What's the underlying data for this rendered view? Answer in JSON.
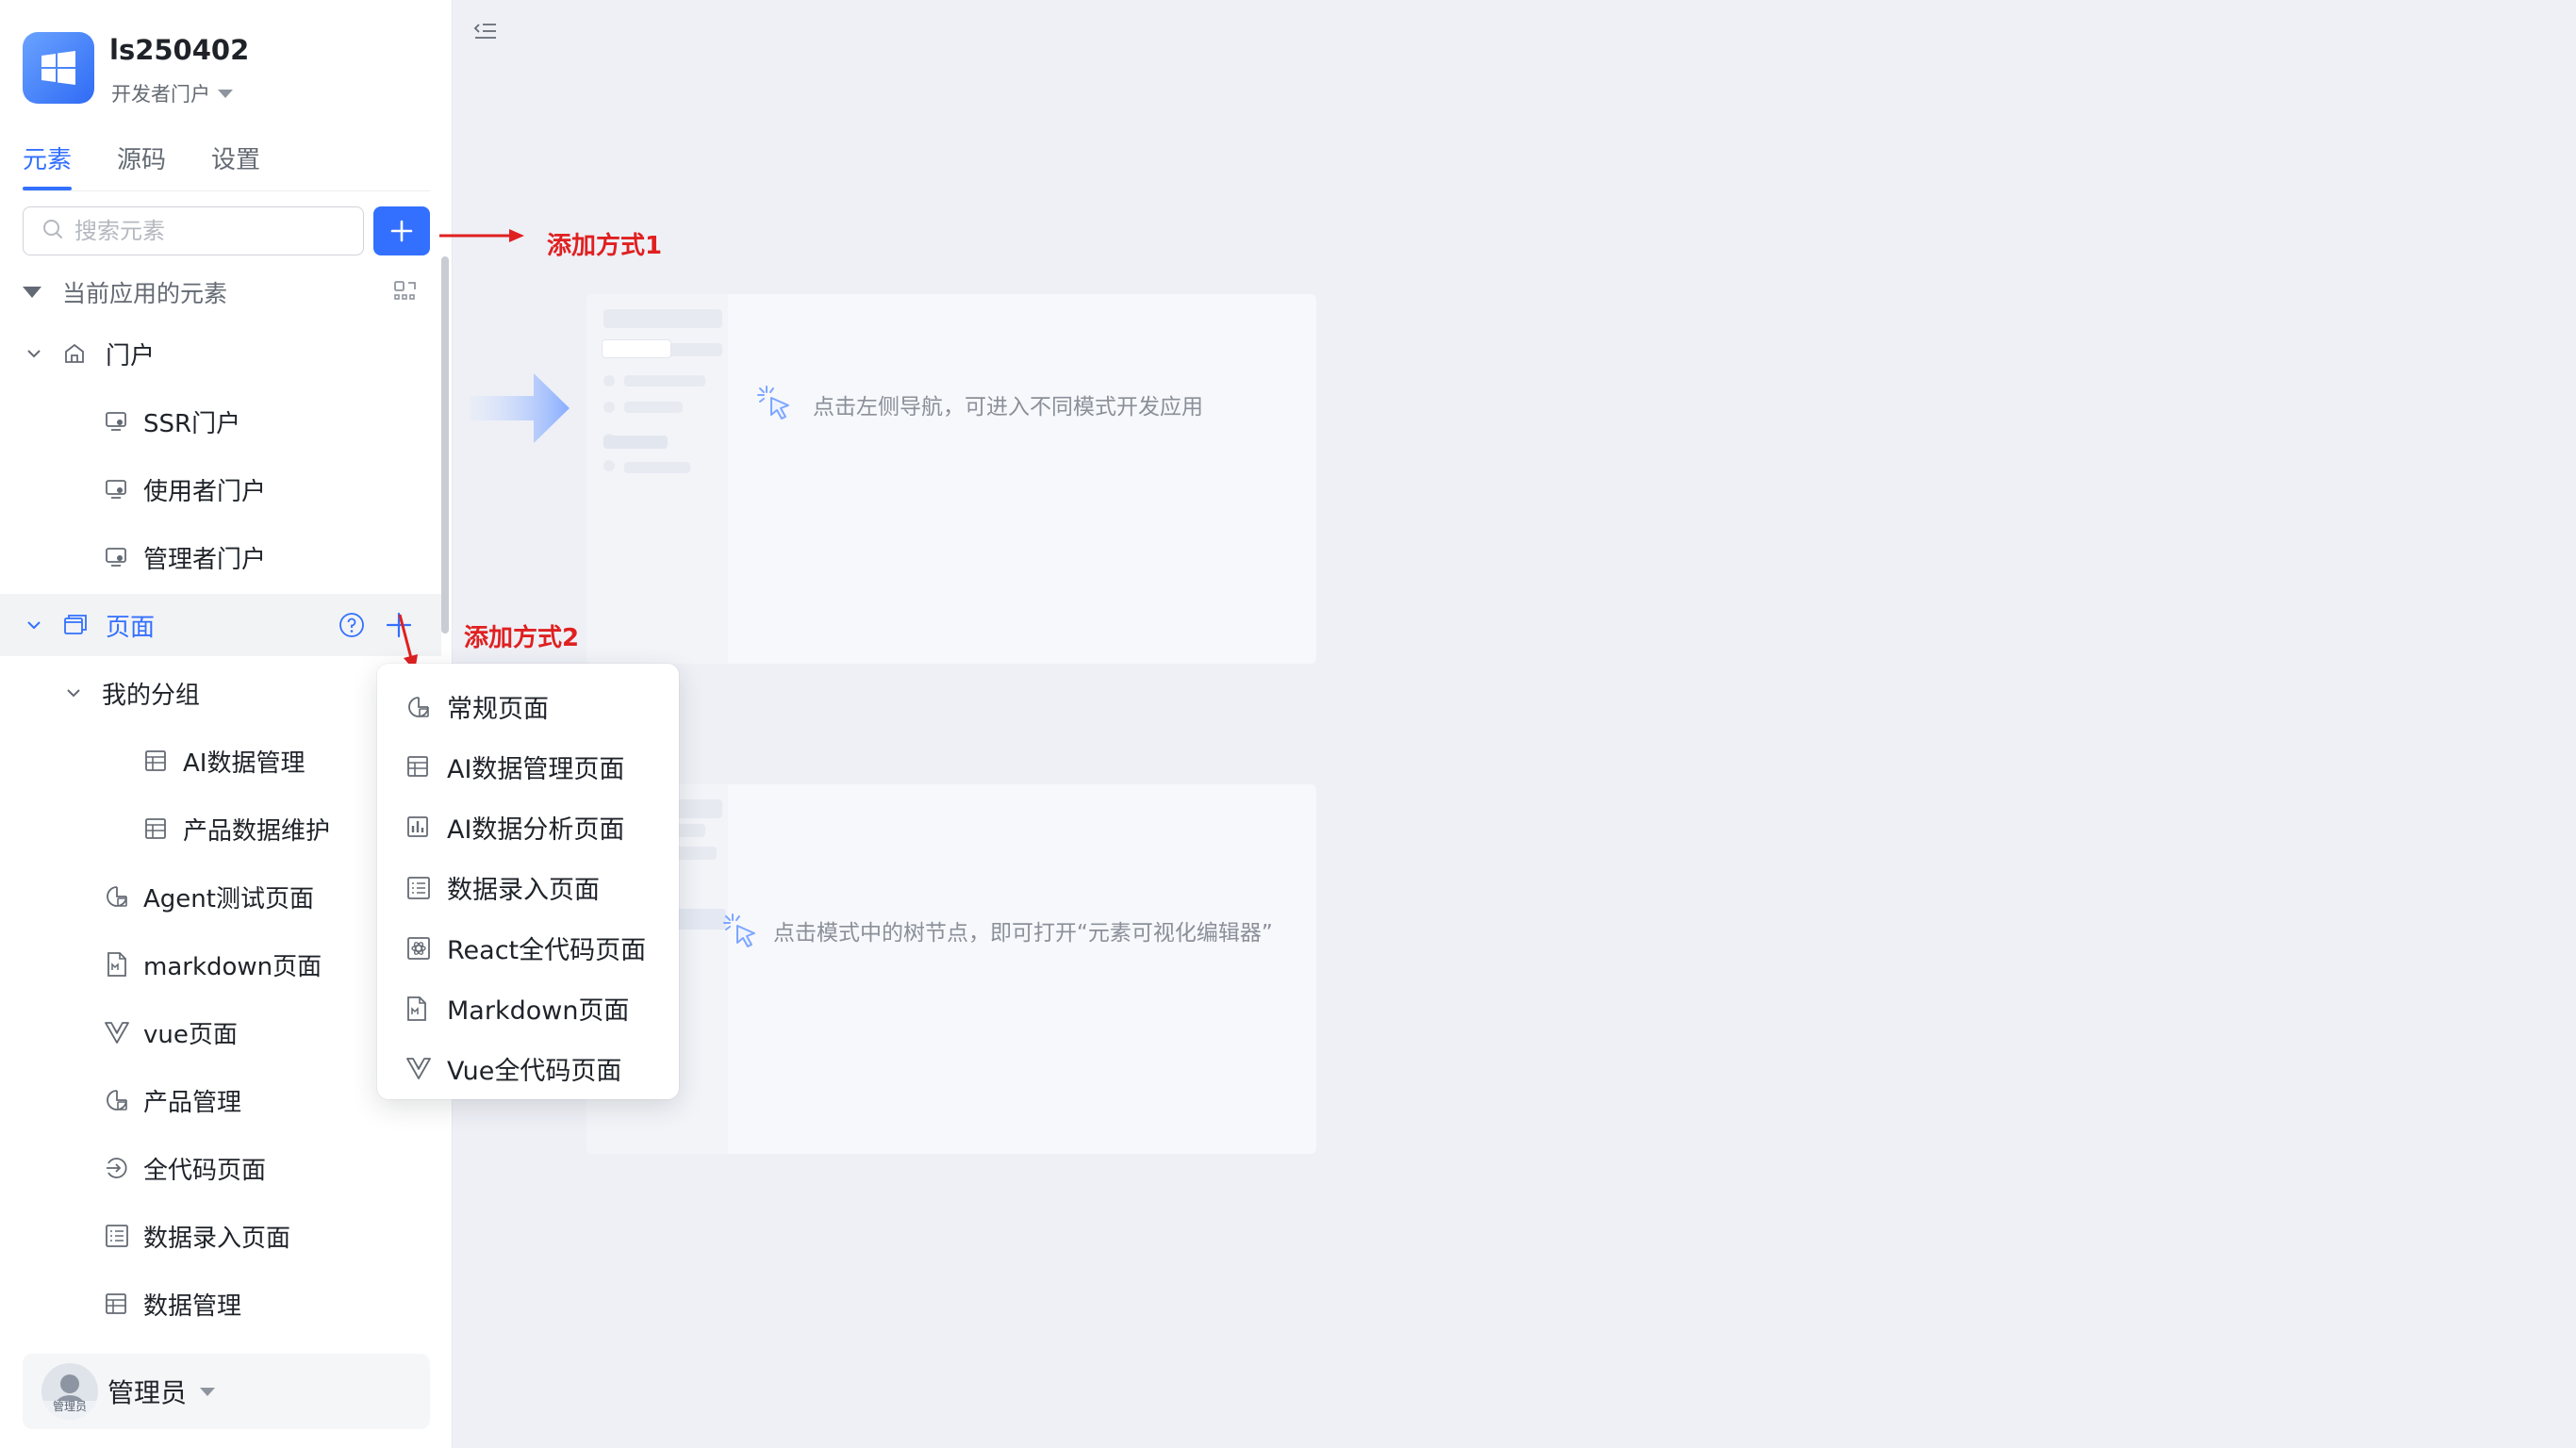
{
  "app": {
    "name": "ls250402",
    "portal": "开发者门户"
  },
  "tabs": [
    {
      "label": "元素",
      "active": true
    },
    {
      "label": "源码",
      "active": false
    },
    {
      "label": "设置",
      "active": false
    }
  ],
  "search": {
    "placeholder": "搜索元素",
    "value": ""
  },
  "section": {
    "title": "当前应用的元素"
  },
  "tree": {
    "portal_group": "门户",
    "portals": [
      "SSR门户",
      "使用者门户",
      "管理者门户"
    ],
    "pages_group": "页面",
    "my_group": "我的分组",
    "group_items": [
      "AI数据管理",
      "产品数据维护"
    ],
    "pages": [
      {
        "label": "Agent测试页面",
        "icon": "chart-page-icon"
      },
      {
        "label": "markdown页面",
        "icon": "markdown-file-icon"
      },
      {
        "label": "vue页面",
        "icon": "vue-icon"
      },
      {
        "label": "产品管理",
        "icon": "chart-page-icon"
      },
      {
        "label": "全代码页面",
        "icon": "code-arrow-icon"
      },
      {
        "label": "数据录入页面",
        "icon": "form-list-icon"
      },
      {
        "label": "数据管理",
        "icon": "table-icon"
      }
    ]
  },
  "dropdown": {
    "items": [
      {
        "label": "常规页面",
        "icon": "chart-page-icon"
      },
      {
        "label": "AI数据管理页面",
        "icon": "table-icon"
      },
      {
        "label": "AI数据分析页面",
        "icon": "bar-chart-icon"
      },
      {
        "label": "数据录入页面",
        "icon": "form-list-icon"
      },
      {
        "label": "React全代码页面",
        "icon": "react-code-icon"
      },
      {
        "label": "Markdown页面",
        "icon": "markdown-file-icon"
      },
      {
        "label": "Vue全代码页面",
        "icon": "vue-icon"
      }
    ]
  },
  "user": {
    "name": "管理员",
    "avatar_label": "管理员"
  },
  "annotations": {
    "method1": "添加方式1",
    "method2": "添加方式2"
  },
  "hints": {
    "nav_hint": "点击左侧导航，可进入不同模式开发应用",
    "tree_hint": "点击模式中的树节点，即可打开“元素可视化编辑器”"
  },
  "colors": {
    "accent": "#3370ff",
    "annotation": "#e02020",
    "background": "#eef0f6"
  }
}
